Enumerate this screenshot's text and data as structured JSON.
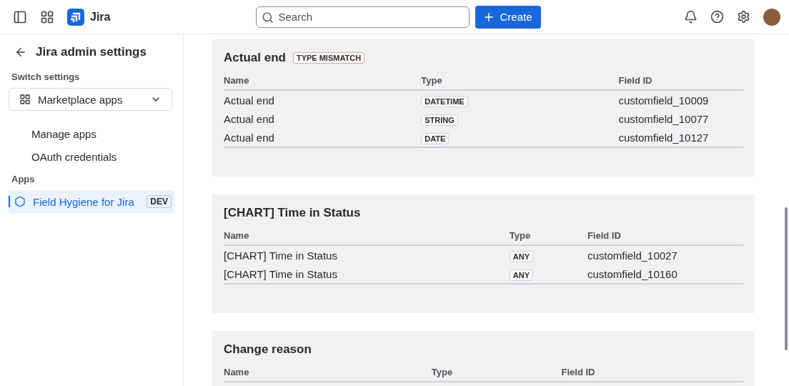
{
  "topbar": {
    "product": "Jira",
    "search": {
      "placeholder": "Search"
    },
    "create_button": "Create"
  },
  "sidebar": {
    "back_title": "Jira admin settings",
    "switch_label": "Switch settings",
    "switch_select": "Marketplace apps",
    "items": [
      {
        "label": "Manage apps",
        "selected": false
      },
      {
        "label": "OAuth credentials",
        "selected": false
      }
    ],
    "apps_label": "Apps",
    "apps": [
      {
        "label": "Field Hygiene for Jira",
        "badge": "DEV",
        "selected": true
      }
    ]
  },
  "cards": [
    {
      "title": "Actual end",
      "badge": "TYPE MISMATCH",
      "columns": [
        "Name",
        "Type",
        "Field ID"
      ],
      "rows": [
        {
          "name": "Actual end",
          "type": "DATETIME",
          "field_id": "customfield_10009"
        },
        {
          "name": "Actual end",
          "type": "STRING",
          "field_id": "customfield_10077"
        },
        {
          "name": "Actual end",
          "type": "DATE",
          "field_id": "customfield_10127"
        }
      ]
    },
    {
      "title": "[CHART] Time in Status",
      "columns": [
        "Name",
        "Type",
        "Field ID"
      ],
      "rows": [
        {
          "name": "[CHART] Time in Status",
          "type": "ANY",
          "field_id": "customfield_10027"
        },
        {
          "name": "[CHART] Time in Status",
          "type": "ANY",
          "field_id": "customfield_10160"
        }
      ]
    },
    {
      "title": "Change reason",
      "columns": [
        "Name",
        "Type",
        "Field ID"
      ]
    }
  ]
}
